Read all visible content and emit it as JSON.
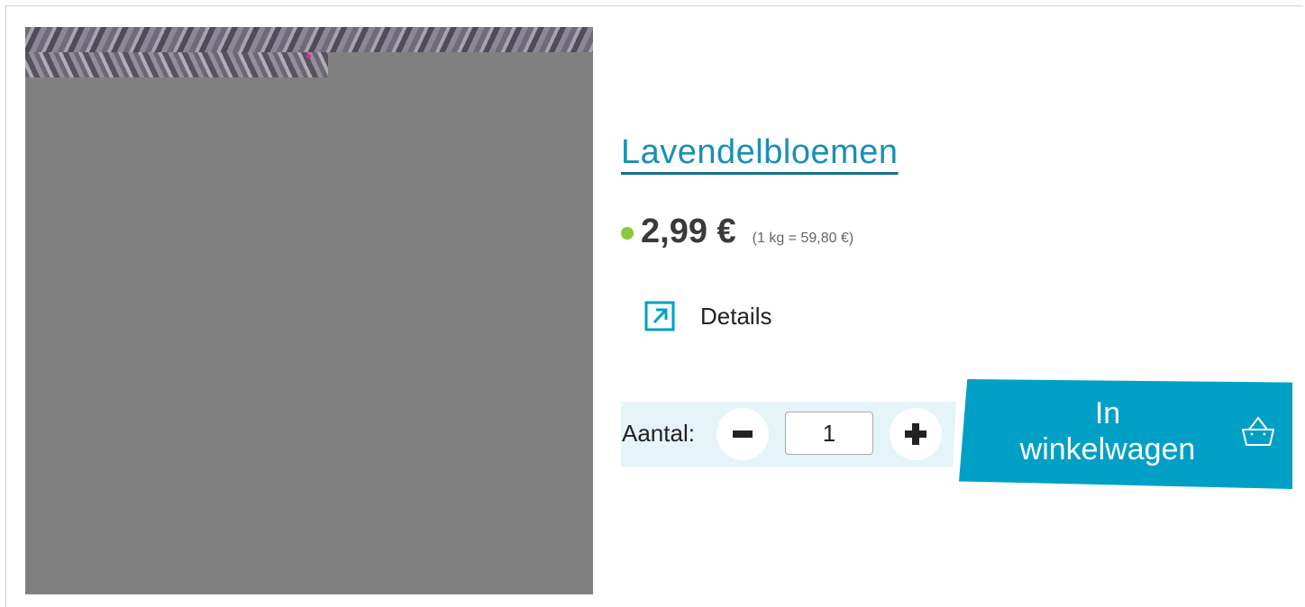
{
  "product": {
    "title": "Lavendelbloemen",
    "price": "2,99 €",
    "unit_price": "(1 kg = 59,80 €)",
    "stock_color": "#8cc63f"
  },
  "details": {
    "label": "Details",
    "icon": "external-arrow-icon"
  },
  "quantity": {
    "label": "Aantal:",
    "value": "1",
    "minus_icon": "minus-icon",
    "plus_icon": "plus-icon"
  },
  "cart": {
    "label_line1": "In",
    "label_line2": "winkelwagen",
    "icon": "basket-icon",
    "color": "#00a0c6"
  },
  "colors": {
    "link": "#1a8fb5",
    "panel": "#e4f4f9",
    "image_placeholder": "#808080"
  }
}
